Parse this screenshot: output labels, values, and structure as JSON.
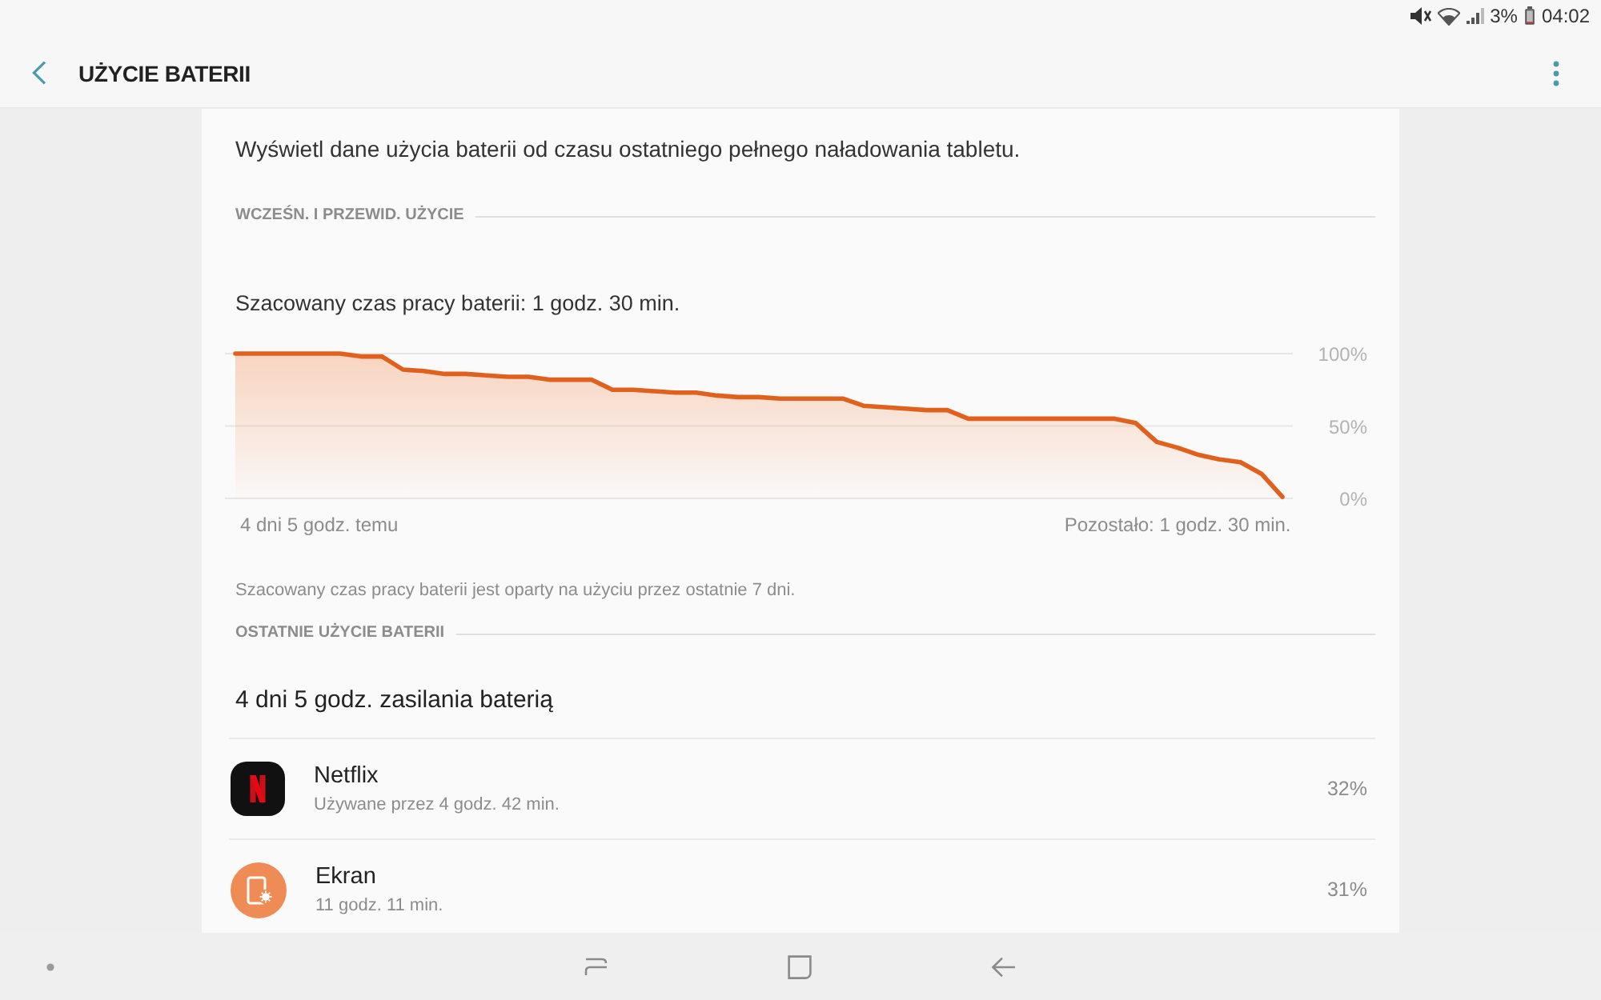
{
  "status_bar": {
    "battery": "3%",
    "time": "04:02"
  },
  "header": {
    "title": "UŻYCIE BATERII"
  },
  "description": "Wyświetl dane użycia baterii od czasu ostatniego pełnego naładowania tabletu.",
  "estimate_section": {
    "heading": "WCZEŚN. I PRZEWID. UŻYCIE",
    "estimate": "Szacowany czas pracy baterii: 1 godz. 30 min.",
    "chart_data": {
      "type": "area",
      "categories": [
        null,
        null,
        null,
        null,
        "4 dni 5 godz. temu",
        null,
        null,
        null,
        null,
        null,
        null,
        null,
        null,
        null,
        null,
        null,
        null,
        null,
        null,
        null,
        null,
        null,
        null,
        null,
        null,
        null,
        null,
        null,
        null,
        null,
        null,
        null,
        null,
        null,
        null,
        null,
        null,
        null,
        null,
        null,
        null,
        null,
        null,
        null,
        null,
        "Pozostało: 1 godz. 30 min.",
        null,
        null,
        null,
        null,
        null
      ],
      "values": [
        100,
        100,
        100,
        100,
        100,
        100,
        98,
        98,
        89,
        88,
        86,
        86,
        85,
        84,
        84,
        82,
        82,
        82,
        75,
        75,
        74,
        73,
        73,
        71,
        70,
        70,
        69,
        69,
        69,
        69,
        64,
        63,
        62,
        61,
        61,
        55,
        55,
        55,
        55,
        55,
        55,
        55,
        55,
        52,
        39,
        35,
        30,
        27,
        25,
        17,
        1
      ],
      "ylim": [
        0,
        100
      ],
      "yticks": [
        {
          "value": 100,
          "label": "100%"
        },
        {
          "value": 50,
          "label": "50%"
        },
        {
          "value": 0,
          "label": "0%"
        }
      ]
    },
    "note": "Szacowany czas pracy baterii jest oparty na użyciu przez ostatnie 7 dni."
  },
  "recent_section": {
    "heading": "OSTATNIE UŻYCIE BATERII",
    "summary": "4 dni 5 godz. zasilania baterią",
    "items": [
      {
        "kind": "app",
        "name": "Netflix",
        "detail": "Używane przez 4 godz. 42 min.",
        "percent": "32%"
      },
      {
        "kind": "screen",
        "name": "Ekran",
        "detail": "11 godz. 11 min.",
        "percent": "31%"
      }
    ]
  }
}
